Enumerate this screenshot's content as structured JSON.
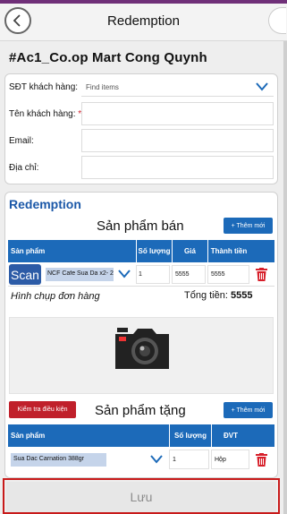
{
  "header": {
    "title": "Redemption"
  },
  "store_name": "#Ac1_Co.op Mart Cong Quynh",
  "customer_form": {
    "phone_label": "SĐT khách hàng:",
    "phone_placeholder": "Find items",
    "name_label": "Tên khách hàng:",
    "name_required_mark": "*",
    "email_label": "Email:",
    "address_label": "Địa chỉ:"
  },
  "redemption": {
    "section_title": "Redemption",
    "sale": {
      "title": "Sản phẩm bán",
      "add_button": "+ Thêm mới",
      "columns": {
        "product": "Sản phẩm",
        "quantity": "Số lượng",
        "price": "Giá",
        "amount": "Thành tiền"
      },
      "rows": [
        {
          "product": "NCF Cafe Sua Da x2- 24",
          "quantity": "1",
          "price": "5555",
          "amount": "5555"
        }
      ],
      "scan_button": "Scan",
      "photo_label": "Hình chụp đơn hàng",
      "total_label": "Tổng tiền:",
      "total_value": "5555"
    },
    "gift": {
      "check_button": "Kiểm tra điều kiện",
      "title": "Sản phẩm tặng",
      "add_button": "+ Thêm mới",
      "columns": {
        "product": "Sản phẩm",
        "quantity": "Số lượng",
        "unit": "ĐVT"
      },
      "rows": [
        {
          "product": "Sua Dac Carnation 388gr",
          "quantity": "1",
          "unit": "Hộp"
        }
      ]
    }
  },
  "footer": {
    "save_button": "Lưu"
  },
  "icons": {
    "back": "chevron-left-icon",
    "dropdown": "chevron-down-icon",
    "delete": "trash-icon",
    "camera": "camera-icon"
  },
  "colors": {
    "accent_blue": "#1c6ab9",
    "title_blue": "#1b58a8",
    "danger_red": "#c0202b",
    "top_bar": "#6f2f78"
  }
}
